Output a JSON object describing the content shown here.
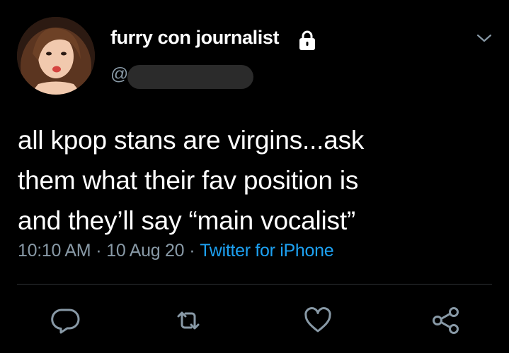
{
  "tweet": {
    "display_name": "furry con journalist",
    "handle_prefix": "@",
    "text_lines": [
      "all kpop stans are virgins...ask",
      "them what their fav position is",
      "and they’ll say “main vocalist”"
    ],
    "time": "10:10 AM",
    "date": "10 Aug 20",
    "separator": "·",
    "source": "Twitter for iPhone"
  },
  "icons": {
    "protected": "lock-icon",
    "more": "chevron-down-icon",
    "reply": "reply-icon",
    "retweet": "retweet-icon",
    "like": "heart-icon",
    "share": "share-icon"
  },
  "colors": {
    "background": "#000000",
    "text": "#ffffff",
    "secondary_text": "#8899a6",
    "link": "#1da1f2",
    "icon": "#8899a6",
    "divider": "#2f3336"
  }
}
